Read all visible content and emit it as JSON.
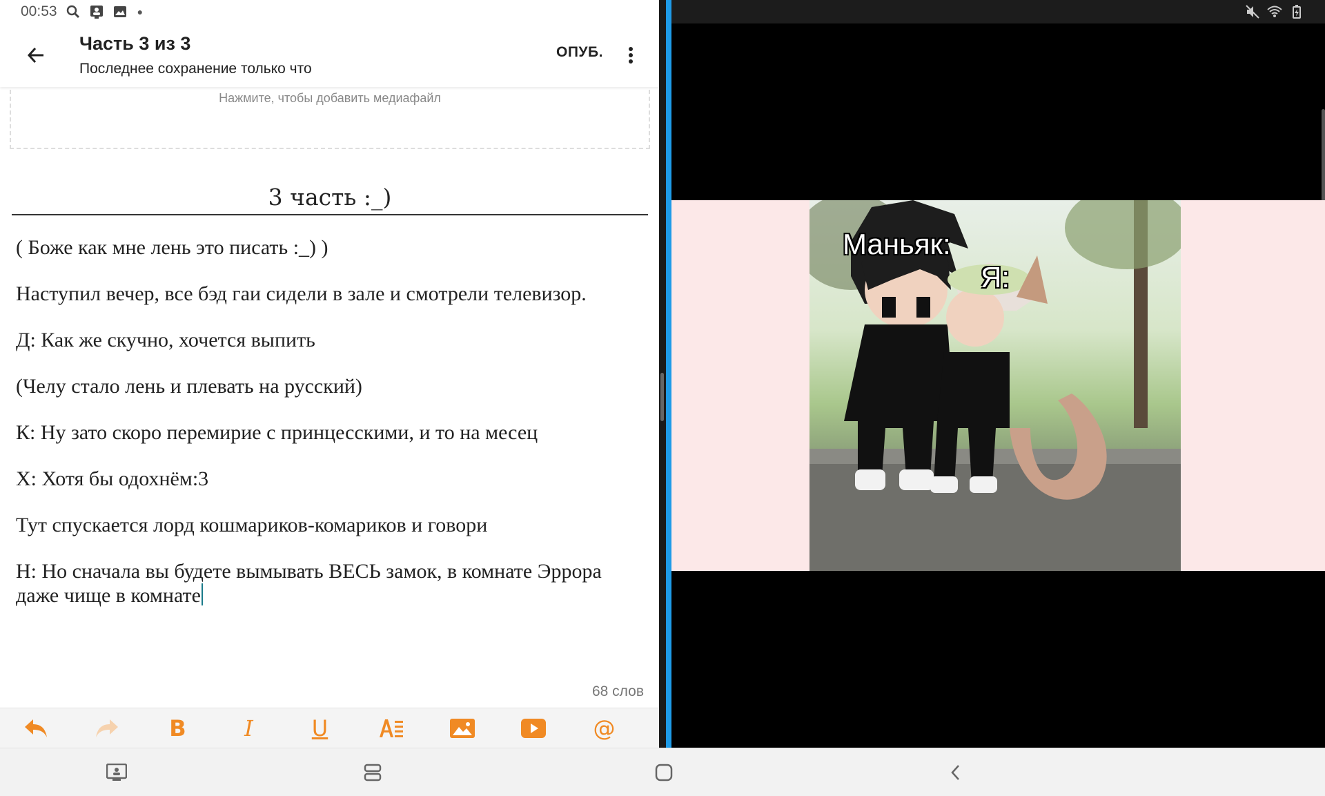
{
  "status_bar": {
    "time": "00:53",
    "left_icons": [
      "search-icon",
      "contact-card-icon",
      "image-icon"
    ],
    "right_icons": [
      "mute-icon",
      "wifi-icon",
      "battery-icon"
    ]
  },
  "editor": {
    "part_title": "Часть 3 из 3",
    "save_status": "Последнее сохранение только что",
    "publish_label": "ОПУБ.",
    "media_hint": "Нажмите, чтобы добавить медиафайл",
    "chapter_title": "3 часть :_)",
    "paragraphs": [
      "( Боже как мне лень это писать :_) )",
      "Наступил вечер, все бэд гаи сидели в зале и смотрели телевизор.",
      "Д: Как же скучно, хочется выпить",
      "(Челу стало лень и плевать на русский)",
      "К: Ну зато скоро перемирие с принцесскими, и то на месец",
      "Х: Хотя бы одохнём:3",
      "Тут спускается лорд кошмариков-комариков и говори",
      "Н: Но сначала вы будете вымывать ВЕСЬ замок, в комнате Эррора даже чище в комнате"
    ],
    "word_count": "68 слов",
    "format_toolbar": {
      "bold": "B",
      "italic": "I",
      "underline": "U",
      "at": "@"
    },
    "accent_color": "#f08a24"
  },
  "video": {
    "caption_left": "Маньяк:",
    "caption_right": "Я:"
  },
  "divider_color": "#1e9be8"
}
